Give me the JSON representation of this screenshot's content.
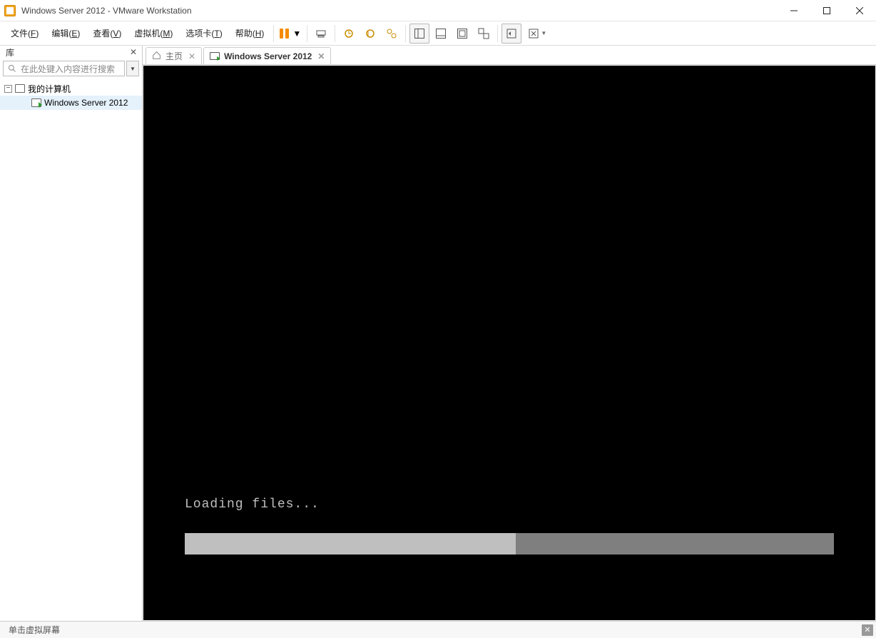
{
  "window": {
    "title": "Windows Server 2012 - VMware Workstation"
  },
  "menu": {
    "file": "文件(F)",
    "edit": "编辑(E)",
    "view": "查看(V)",
    "vm": "虚拟机(M)",
    "tabs": "选项卡(T)",
    "help": "帮助(H)"
  },
  "sidebar": {
    "title": "库",
    "search_placeholder": "在此处键入内容进行搜索",
    "tree_root": "我的计算机",
    "tree_child": "Windows Server 2012"
  },
  "tabs": {
    "home": "主页",
    "vm": "Windows Server 2012"
  },
  "vm_console": {
    "loading_text": "Loading files...",
    "progress_percent": 51
  },
  "statusbar": {
    "hint": "单击虚拟屏幕"
  }
}
